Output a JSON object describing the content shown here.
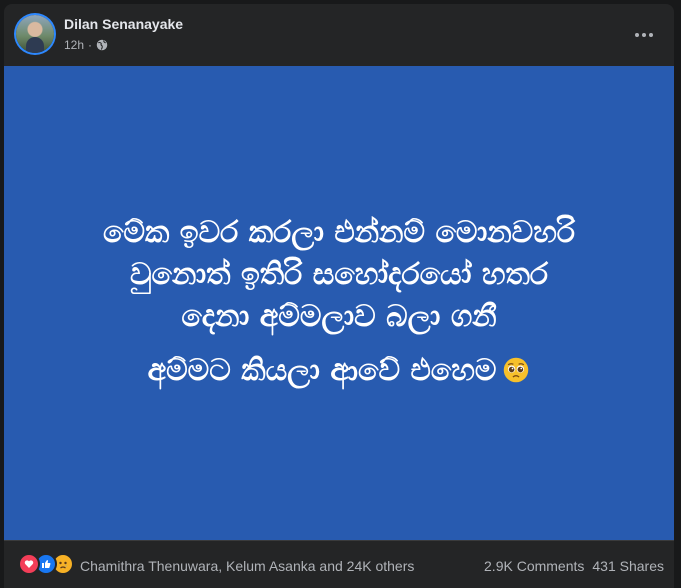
{
  "post": {
    "author": "Dilan Senanayake",
    "time": "12h",
    "privacy_icon": "globe-icon",
    "menu_icon": "more-horizontal-icon"
  },
  "content": {
    "background_color": "#285bb0",
    "lines": [
      "මේක ඉවර කරලා එන්නම් මොනවහරි",
      "වුනොත් ඉතිරි සහෝදරයෝ හතර",
      "දෙනා අම්මලාව බලා ගනී",
      "අම්මට කියලා ආවේ එහෙම"
    ],
    "emoji": "pleading-face-emoji"
  },
  "engagement": {
    "reaction_icons": [
      "love-icon",
      "like-icon",
      "sad-icon"
    ],
    "reactors_text": "Chamithra Thenuwara, Kelum Asanka and 24K others",
    "comments": "2.9K Comments",
    "shares": "431 Shares"
  }
}
